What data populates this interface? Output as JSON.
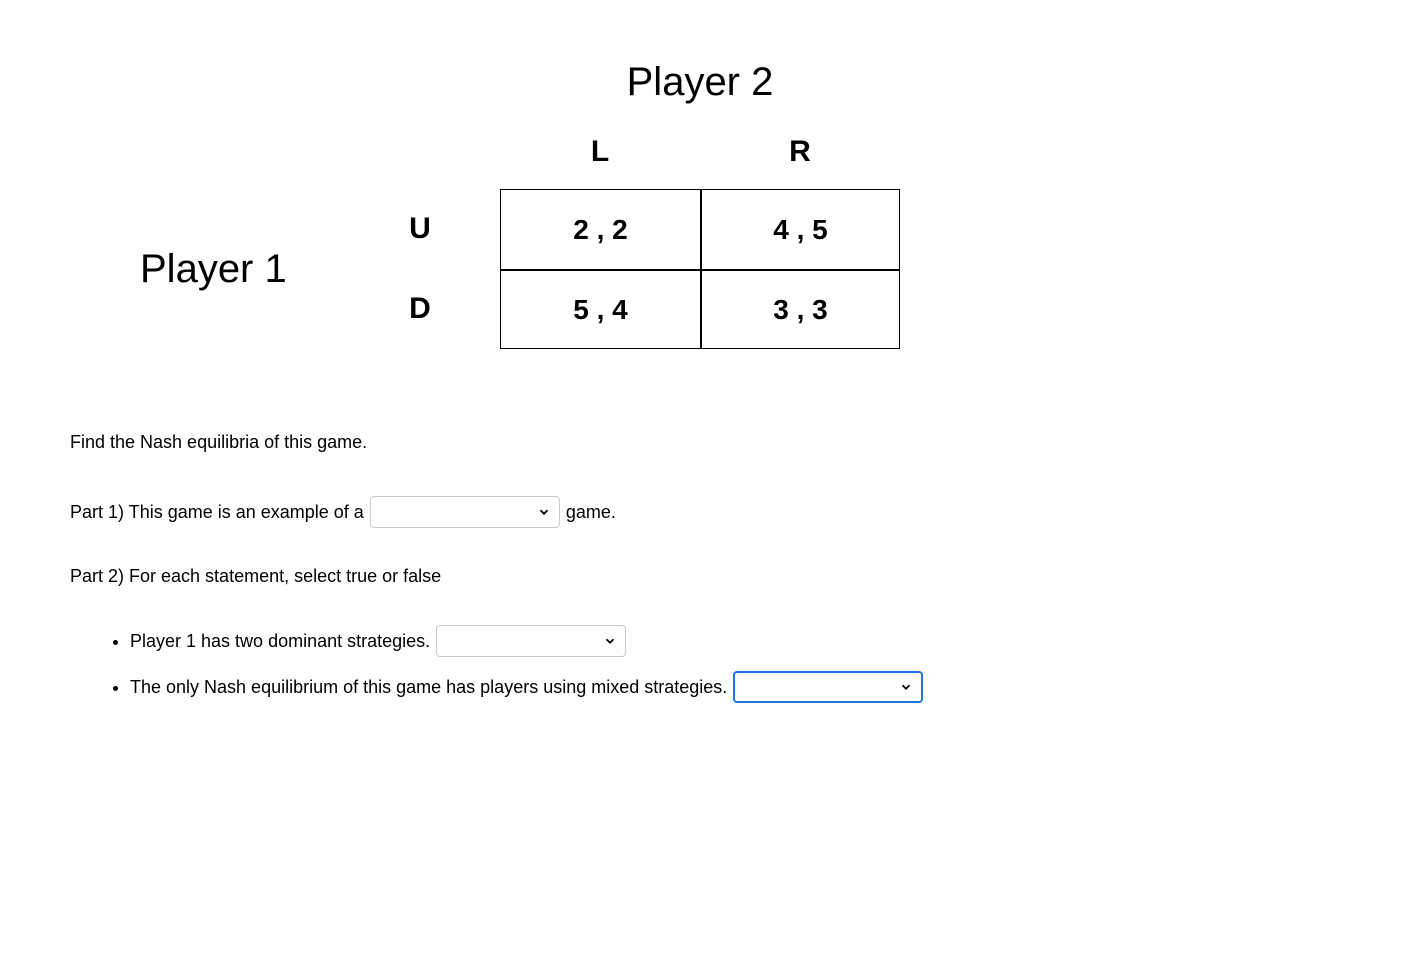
{
  "matrix": {
    "player1_label": "Player 1",
    "player2_label": "Player 2",
    "col_headers": {
      "left": "L",
      "right": "R"
    },
    "row_headers": {
      "up": "U",
      "down": "D"
    },
    "cells": {
      "UL": "2 , 2",
      "UR": "4 , 5",
      "DL": "5 , 4",
      "DR": "3 , 3"
    }
  },
  "question": {
    "instruction": "Find the Nash equilibria of this game.",
    "part1": {
      "prefix": "Part 1) This game is an example of a",
      "suffix": "game.",
      "select_value": ""
    },
    "part2": {
      "header": "Part 2) For each statement, select true or false",
      "statements": [
        {
          "text": "Player 1 has two dominant strategies.",
          "select_value": ""
        },
        {
          "text": "The only Nash equilibrium of this game has players using mixed strategies.",
          "select_value": ""
        }
      ]
    }
  }
}
